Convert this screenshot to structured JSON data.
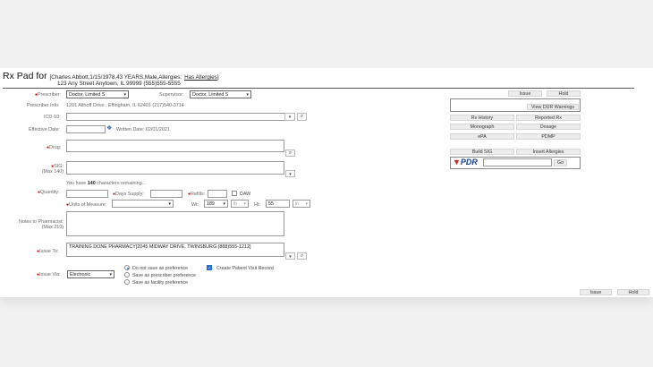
{
  "header": {
    "title": "Rx Pad for",
    "patient_info": "[Charles Abbott,1/15/1978,43 YEARS,Male,Allergies:",
    "allergies_link": "Has Allergies",
    "bracket_close": "]",
    "address": "123 Any Street Anytown, IL 99999  (555)555-5555"
  },
  "form": {
    "prescriber_label": "Prescriber:",
    "prescriber_value": "Doctor, Limited S",
    "supervisor_label": "Supervisor:",
    "supervisor_value": "Doctor, Limited S",
    "prescriber_info_label": "Prescriber Info:",
    "prescriber_info_value": "1201 Althoff Drive , Effingham, IL 62401  (217)540-3714",
    "icd_label": "ICD-10:",
    "effective_date_label": "Effective Date:",
    "written_date": "Written Date: 02/01/2021",
    "drug_label": "Drug:",
    "sig_label": "SIG:",
    "sig_max": "(Max 140)",
    "chars_prefix": "You have ",
    "chars_count": "140",
    "chars_suffix": " characters remaining...",
    "quantity_label": "Quantity:",
    "days_supply_label": "Days Supply:",
    "refills_label": "Refills:",
    "daw_label": "DAW",
    "units_label": "Units of Measure:",
    "wt_label": "Wt:",
    "wt_value": "189",
    "wt_unit": "lb",
    "ht_label": "Ht:",
    "ht_value": "55",
    "ht_unit": "in",
    "notes_label": "Notes to Pharmacist:",
    "notes_max": "(Max 210)",
    "issue_to_label": "Issue To:",
    "issue_to_value": "TRAINING DONE PHARMACY[2045 MIDWAY DRIVE, TWINSBURG (888)555-1212]",
    "issue_via_label": "Issue Via:",
    "issue_via_value": "Electronic",
    "radio_options": [
      "Do not save as preference",
      "Save as prescriber preference",
      "Save as facility preference"
    ],
    "create_visit_label": "Create Patient Visit Record"
  },
  "right_panel": {
    "issue": "Issue",
    "hold": "Hold",
    "view_dur": "View DUR Warnings",
    "rx_history": "Rx History",
    "reported_rx": "Reported Rx",
    "monograph": "Monograph",
    "dosage": "Dosage",
    "epa": "ePA",
    "pdmp": "PDMP",
    "build_sig": "Build SIG",
    "insert_allergies": "Insert Allergies",
    "pdr_logo": "PDR",
    "go": "Go"
  },
  "footer": {
    "issue": "Issue",
    "hold": "Hold"
  },
  "colors": {
    "link": "#1a5fb4",
    "required": "#cc0000",
    "checkbox": "#1f6fd1"
  }
}
